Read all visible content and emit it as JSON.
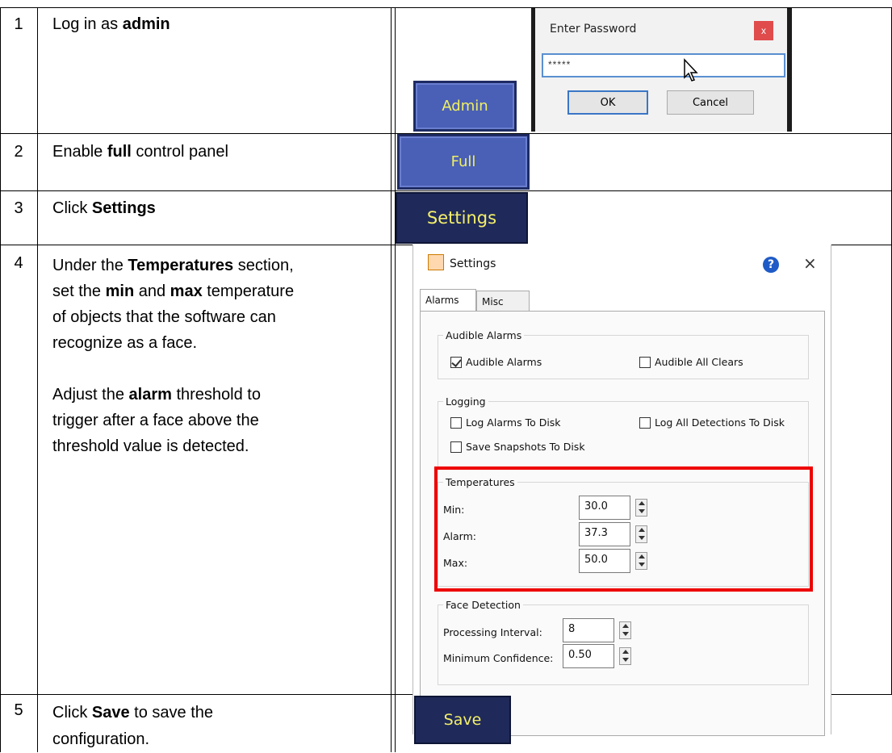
{
  "rows": [
    {
      "num": "1",
      "parts": [
        {
          "t": "Log in as "
        },
        {
          "t": "admin",
          "b": true
        }
      ]
    },
    {
      "num": "2",
      "parts": [
        {
          "t": "Enable "
        },
        {
          "t": "full",
          "b": true
        },
        {
          "t": " control panel"
        }
      ]
    },
    {
      "num": "3",
      "parts": [
        {
          "t": "Click "
        },
        {
          "t": "Settings",
          "b": true
        }
      ]
    },
    {
      "num": "4",
      "parts": [
        {
          "t": "Under the "
        },
        {
          "t": "Temperatures",
          "b": true
        },
        {
          "t": " section,"
        },
        {
          "br": true
        },
        {
          "t": "set the "
        },
        {
          "t": "min",
          "b": true
        },
        {
          "t": " and "
        },
        {
          "t": "max",
          "b": true
        },
        {
          "t": " temperature"
        },
        {
          "br": true
        },
        {
          "t": "of objects that the software can"
        },
        {
          "br": true
        },
        {
          "t": "recognize as a face."
        },
        {
          "br": true
        },
        {
          "br": true
        },
        {
          "t": "Adjust the "
        },
        {
          "t": "alarm",
          "b": true
        },
        {
          "t": " threshold to"
        },
        {
          "br": true
        },
        {
          "t": "trigger after a face above the"
        },
        {
          "br": true
        },
        {
          "t": "threshold value is detected."
        }
      ]
    },
    {
      "num": "5",
      "parts": [
        {
          "t": "Click "
        },
        {
          "t": "Save",
          "b": true
        },
        {
          "t": " to save the"
        },
        {
          "br": true
        },
        {
          "t": "configuration."
        }
      ]
    }
  ],
  "buttons": {
    "admin": "Admin",
    "full": "Full",
    "settings": "Settings",
    "save": "Save"
  },
  "password_dialog": {
    "title": "Enter Password",
    "close": "x",
    "masked_value": "*****",
    "ok": "OK",
    "cancel": "Cancel"
  },
  "settings_window": {
    "title": "Settings",
    "help": "?",
    "close": "×",
    "tabs": [
      "Alarms",
      "Misc"
    ],
    "audible": {
      "group": "Audible Alarms",
      "audible_alarms": "Audible Alarms",
      "audible_alarms_checked": true,
      "audible_all_clears": "Audible All Clears",
      "audible_all_clears_checked": false
    },
    "logging": {
      "group": "Logging",
      "log_alarms": "Log Alarms To Disk",
      "log_all_detections": "Log All Detections To Disk",
      "save_snapshots": "Save Snapshots To Disk"
    },
    "temperatures": {
      "group": "Temperatures",
      "min_label": "Min:",
      "min_value": "30.0",
      "alarm_label": "Alarm:",
      "alarm_value": "37.3",
      "max_label": "Max:",
      "max_value": "50.0"
    },
    "face_detection": {
      "group": "Face Detection",
      "interval_label": "Processing Interval:",
      "interval_value": "8",
      "confidence_label": "Minimum Confidence:",
      "confidence_value": "0.50"
    }
  },
  "highlight_color": "#ee0000"
}
